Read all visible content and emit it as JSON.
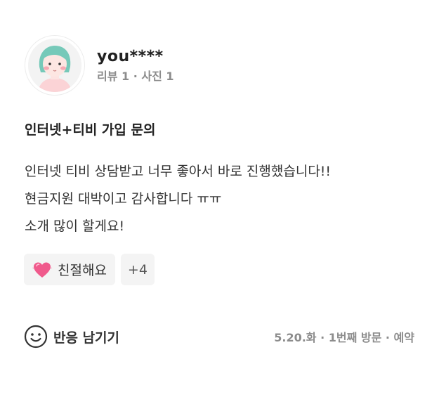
{
  "profile": {
    "username": "you****",
    "stats": "리뷰 1 · 사진 1",
    "avatar_icon": "cartoon-avatar-icon"
  },
  "review": {
    "title": "인터넷+티비 가입 문의",
    "lines": [
      "인터넷 티비 상담받고 너무 좋아서 바로 진행했습니다!!",
      "현금지원 대박이고 감사합니다 ㅠㅠ",
      "소개 많이 할게요!"
    ]
  },
  "tags": {
    "kind": {
      "icon": "pink-heart-icon",
      "label": "친절해요"
    },
    "more": "+4"
  },
  "footer": {
    "react_icon": "smiley-icon",
    "react_label": "반응 남기기",
    "visit_meta": "5.20.화 · 1번째 방문 · 예약"
  },
  "colors": {
    "text": "#222222",
    "muted": "#8c8c8c",
    "tag_bg": "#f4f4f4",
    "heart": "#f05a8c"
  }
}
